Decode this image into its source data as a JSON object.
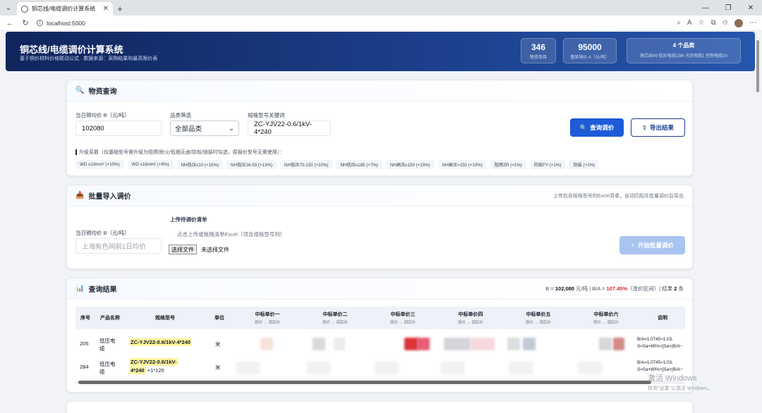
{
  "browser": {
    "tab_title": "铜芯线/电缆调价计算系统",
    "url": "localhost:5000"
  },
  "header": {
    "title": "铜芯线/电缆调价计算系统",
    "subtitle": "基于铜价材料价格联动公式 · 数据来源：采购结果和最高限价表",
    "stats": [
      {
        "num": "346",
        "label": "物资条目"
      },
      {
        "num": "95000",
        "label": "基准铜价 A（元/吨）"
      },
      {
        "num": "4 个品类",
        "label": "铜芯线49 低压电缆(286 光伏电缆1 控制电缆10"
      }
    ]
  },
  "query": {
    "title": "物资查询",
    "price_label": "当日铜均价 B（元/吨）",
    "price_value": "102080",
    "category_label": "品类筛选",
    "category_value": "全部品类",
    "keyword_label": "规格型号关键词",
    "keyword_value": "ZC-YJV22-0.6/1kV-4*240",
    "query_button": "查询调价",
    "export_button": "导出结果",
    "coef_title": "升级系数（仅基础型号需升级为阻燃/耐火/低烟无卤/防蚁/铠装时勾选，原报价型号无需使用）：",
    "coefficients": [
      "WD ≤10mm² (+10%)",
      "WD ≥16mm² (+8%)",
      "NH低压≤10 (+15%)",
      "NH低压16-50 (+13%)",
      "NH低压70-150 (+10%)",
      "NH低压≥185 (+7%)",
      "NH高压≤150 (+15%)",
      "NH高压>150 (+10%)",
      "阻燃ZR (+1%)",
      "防蚁FY (+1%)",
      "铠装 (+1%)"
    ]
  },
  "batch": {
    "title": "批量导入调价",
    "note": "上传包含规格型号的Excel清单，自动匹配并批量调价后导出",
    "price_label": "当日铜均价 B（元/吨）",
    "price_placeholder": "上海有色网前1日均价",
    "upload_label": "上传待调价清单",
    "upload_hint": "点击上传或拖拽清单Excel（须含规格型号列）",
    "file_button": "选择文件",
    "file_none": "未选择文件",
    "start_button": "开始批量调价"
  },
  "results": {
    "title": "查询结果",
    "summary_prefix": "B = ",
    "summary_b": "102,080",
    "summary_mid": " 元/吨 | B/A = ",
    "summary_ratio": "107.45%",
    "summary_mid2": "（涨价区间）| 结果 ",
    "summary_count": "2",
    "summary_suffix": " 条",
    "columns": {
      "idx": "序号",
      "name": "产品名称",
      "model": "规格型号",
      "unit": "单位",
      "bid1": "中标单价一",
      "bid2": "中标单价二",
      "bid3": "中标单价三",
      "bid4": "中标单价四",
      "bid5": "中标单价五",
      "bid6": "中标单价六",
      "note": "说明",
      "sub": "原价 → 调后价"
    },
    "rows": [
      {
        "idx": "205",
        "name1": "低压电",
        "name2": "缆",
        "model1": "ZC-YJV22-0.6/1kV-4*240",
        "model2": "",
        "unit": "米",
        "note1": "B/A=1.0745>1.03,",
        "note2": "S=Sa+80%×[Sa×(B/A−"
      },
      {
        "idx": "284",
        "name1": "低压电",
        "name2": "缆",
        "model1": "ZC-YJV22-0.6/1kV-",
        "model2": "4*240",
        "model_tail": "+1*120",
        "unit": "米",
        "note1": "B/A=1.0745>1.03,",
        "note2": "S=Sa+80%×[Sa×(B/A−"
      }
    ]
  },
  "watermark": {
    "line1": "激活 Windows",
    "line2": "转到\"设置\"以激活 Windows。"
  }
}
